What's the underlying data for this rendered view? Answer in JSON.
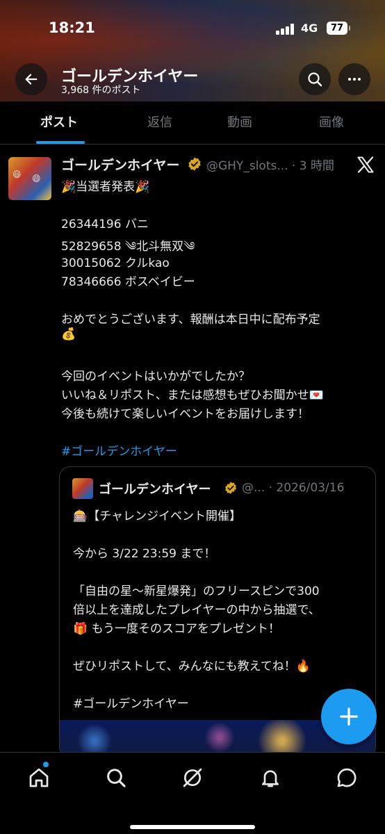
{
  "status_bar": {
    "time": "18:21",
    "network": "4G",
    "battery": "77"
  },
  "header": {
    "title": "ゴールデンホイヤー",
    "post_count": "3,968 件のポスト"
  },
  "tabs": [
    {
      "label": "ポスト",
      "active": true
    },
    {
      "label": "返信",
      "active": false
    },
    {
      "label": "動画",
      "active": false
    },
    {
      "label": "画像",
      "active": false
    }
  ],
  "post": {
    "author_name": "ゴールデンホイヤー",
    "handle_time": "@GHY_slots... · 3 時間",
    "lines": [
      "🎉当選者発表🎉",
      "26344196 バニ",
      "52829658 ༄北斗無双༄",
      "30015062 クルkao",
      "78346666 ボスベイビー",
      "おめでとうございます、報酬は本日中に配布予定",
      "💰",
      "今回のイベントはいかがでしたか？",
      "いいね＆リポスト、または感想もぜひお聞かせ💌",
      "今後も続けて楽しいイベントをお届けします！"
    ],
    "hashtag": "#ゴールデンホイヤー",
    "quote": {
      "author_name": "ゴールデンホイヤー",
      "handle_date": "@... · 2026/03/16",
      "lines": [
        "🎰【チャレンジイベント開催】",
        "今から 3/22 23:59 まで！",
        "「自由の星〜新星爆発」のフリースピンで300",
        "倍以上を達成したプレイヤーの中から抽選で、",
        "🎁 もう一度そのスコアをプレゼント！",
        "ぜひリポストして、みんなにも教えてね！🔥"
      ],
      "hashtag": "#ゴールデンホイヤー"
    }
  },
  "colors": {
    "accent": "#1d9bf0",
    "verified": "#d9a520",
    "background": "#000000",
    "muted": "#71767b"
  },
  "icons": [
    "back-arrow-icon",
    "search-icon",
    "more-icon",
    "verified-icon",
    "x-logo-icon",
    "plus-icon",
    "home-icon",
    "search-nav-icon",
    "grok-icon",
    "bell-icon",
    "messages-icon"
  ]
}
